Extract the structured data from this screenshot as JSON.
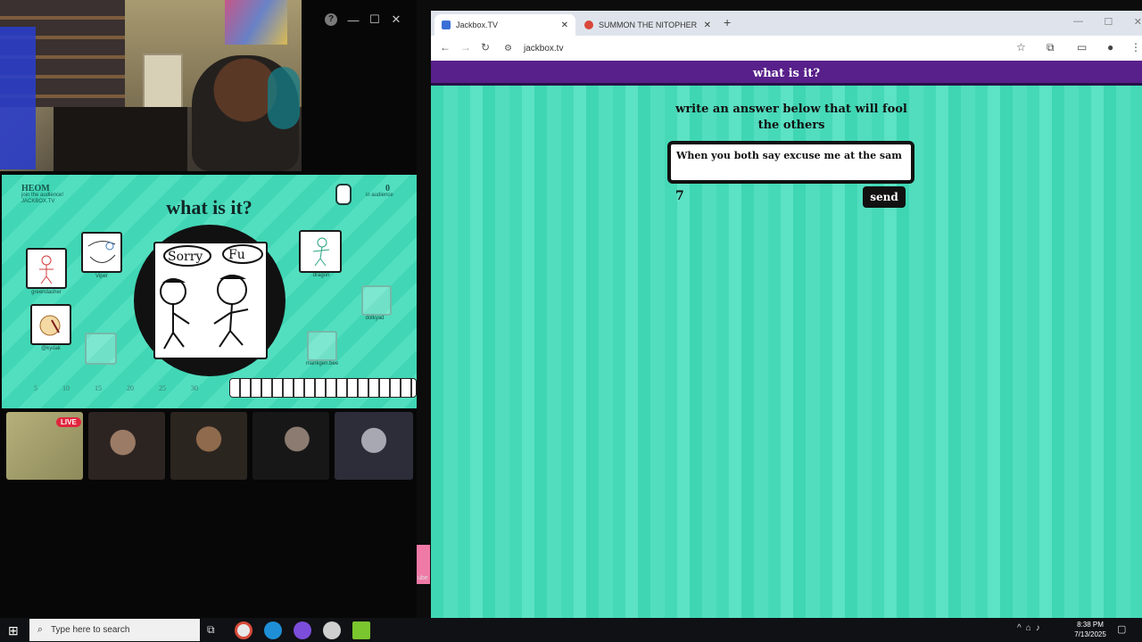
{
  "stream": {
    "game": {
      "room_code": "HEOM",
      "join_text": "join the audience!",
      "site": "JACKBOX.TV",
      "title": "what is it?",
      "audience_count": "0",
      "audience_label": "in audience",
      "players": [
        "greendasher",
        "Viper",
        "@kydak",
        "dragon",
        "dotkyad",
        "mankgen.bee"
      ],
      "drawing_text": [
        "Sorry",
        "Fu"
      ],
      "timeline": [
        "5",
        "10",
        "15",
        "20",
        "25",
        "30"
      ]
    },
    "live_badge": "LIVE",
    "side_snip": "ube"
  },
  "browser": {
    "tabs": [
      {
        "title": "Jackbox.TV",
        "active": true
      },
      {
        "title": "SUMMON THE NITOPHERE adv",
        "active": false
      }
    ],
    "url": "jackbox.tv",
    "page": {
      "header": "what is it?",
      "prompt": "write an answer below that will fool the others",
      "answer_value": "When you both say excuse me at the sam",
      "char_count": "7",
      "send_label": "send"
    }
  },
  "taskbar": {
    "search_placeholder": "Type here to search",
    "time": "8:38 PM",
    "date": "7/13/2025"
  },
  "colors": {
    "header_purple": "#58208a",
    "page_teal": "#46d9b8"
  }
}
